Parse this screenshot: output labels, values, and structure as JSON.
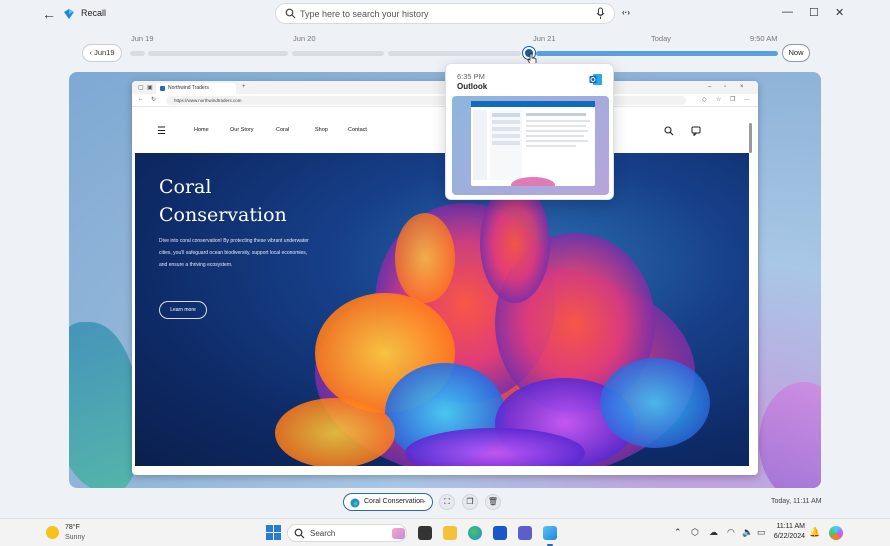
{
  "titlebar": {
    "app_title": "Recall",
    "search_placeholder": "Type here to search your history"
  },
  "timeline": {
    "back_label": "Jun19",
    "now_label": "Now",
    "labels": [
      "Jun 19",
      "Jun 20",
      "Jun 21",
      "Today",
      "9:50 AM"
    ]
  },
  "popup": {
    "time": "6:35 PM",
    "app": "Outlook"
  },
  "browser": {
    "tab_title": "Northwind Traders",
    "address": "https://www.northwindtraders.com",
    "nav": [
      "Home",
      "Our Story",
      "Coral",
      "Shop",
      "Contact"
    ],
    "hero_title": "Coral Conservation",
    "hero_desc": "Dive into coral conservation! By protecting these vibrant underwater cities, you'll safeguard ocean biodiversity, support local economies, and ensure a thriving ecosystem.",
    "hero_button": "Learn more"
  },
  "bottom": {
    "chip_label": "Coral Conservation",
    "chip_more": "···",
    "timestamp": "Today, 11:11 AM"
  },
  "taskbar": {
    "weather_temp": "78°F",
    "weather_cond": "Sunny",
    "search_label": "Search",
    "clock_time": "11:11 AM",
    "clock_date": "6/22/2024"
  },
  "colors": {
    "accent": "#2b67b5",
    "timeline_active": "#5aa0e0",
    "timeline_thumb": "#1a5aa3"
  }
}
